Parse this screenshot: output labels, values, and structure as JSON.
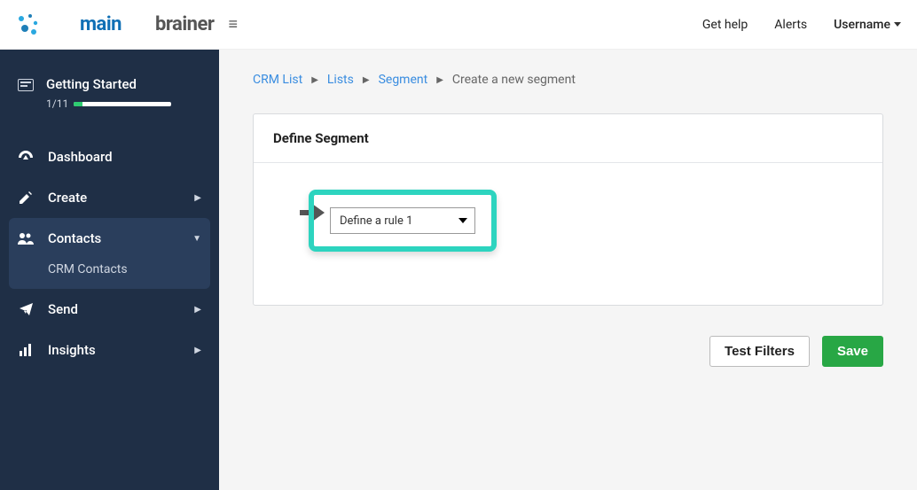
{
  "brand": {
    "main": "main",
    "brainer": "brainer"
  },
  "topnav": {
    "help": "Get help",
    "alerts": "Alerts",
    "username": "Username"
  },
  "sidebar": {
    "getting_started": {
      "label": "Getting Started",
      "progress_text": "1/11",
      "progress_pct": 9
    },
    "items": [
      {
        "label": "Dashboard",
        "icon": "gauge-icon",
        "expandable": false
      },
      {
        "label": "Create",
        "icon": "pencil-icon",
        "expandable": true
      },
      {
        "label": "Contacts",
        "icon": "users-icon",
        "expandable": true,
        "active": true,
        "sub": [
          {
            "label": "CRM Contacts"
          }
        ]
      },
      {
        "label": "Send",
        "icon": "paper-plane-icon",
        "expandable": true
      },
      {
        "label": "Insights",
        "icon": "bar-chart-icon",
        "expandable": true
      }
    ]
  },
  "breadcrumb": {
    "items": [
      {
        "label": "CRM List",
        "link": true
      },
      {
        "label": "Lists",
        "link": true
      },
      {
        "label": "Segment",
        "link": true
      },
      {
        "label": "Create a new segment",
        "link": false
      }
    ]
  },
  "card": {
    "title": "Define Segment",
    "rule_dropdown": "Define a rule 1"
  },
  "buttons": {
    "test_filters": "Test Filters",
    "save": "Save"
  }
}
